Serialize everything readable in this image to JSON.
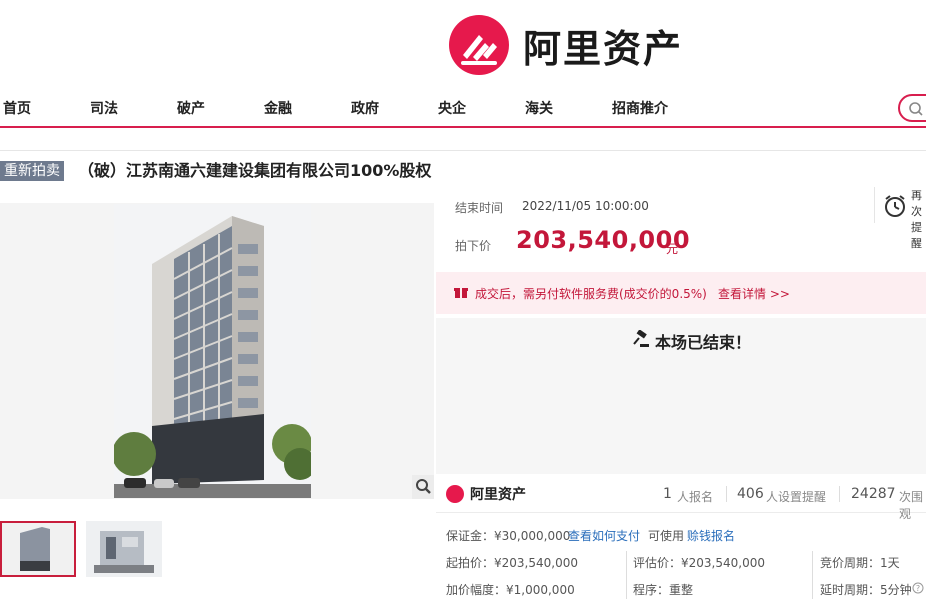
{
  "brand": {
    "name": "阿里资产",
    "accent": "#e6194c"
  },
  "nav": {
    "items": [
      "首页",
      "司法",
      "破产",
      "金融",
      "政府",
      "央企",
      "海关",
      "招商推介"
    ]
  },
  "item": {
    "tag": "重新拍卖",
    "title": "（破）江苏南通六建建设集团有限公司100%股权"
  },
  "auction": {
    "end_label": "结束时间",
    "end_time": "2022/11/05 10:00:00",
    "price_label": "拍下价",
    "price": "203,540,000",
    "price_unit": "元",
    "remind_label": "再次提醒",
    "fee_notice": "成交后，需另付软件服务费(成交价的0.5%)",
    "fee_link": "查看详情 >>",
    "ended_text": "本场已结束！"
  },
  "stats": {
    "platform": "阿里资产",
    "signups_count": "1",
    "signups_label": "人报名",
    "reminders_count": "406",
    "reminders_label": "人设置提醒",
    "views_count": "24287",
    "views_label": "次围观"
  },
  "details": {
    "deposit_label": "保证金：¥30,000,000",
    "deposit_link": "查看如何支付",
    "deposit_also": "可使用",
    "deposit_link2": "赊钱报名",
    "start_price": "起拍价：¥203,540,000",
    "appraisal": "评估价：¥203,540,000",
    "bid_cycle": "竞价周期：1天",
    "increment": "加价幅度：¥1,000,000",
    "procedure": "程序：重整",
    "delay_cycle": "延时周期：5分钟"
  },
  "icons": {
    "search": "search-icon",
    "zoom": "zoom-icon",
    "alarm": "alarm-clock-icon",
    "gift": "gift-icon",
    "gavel": "gavel-icon"
  }
}
